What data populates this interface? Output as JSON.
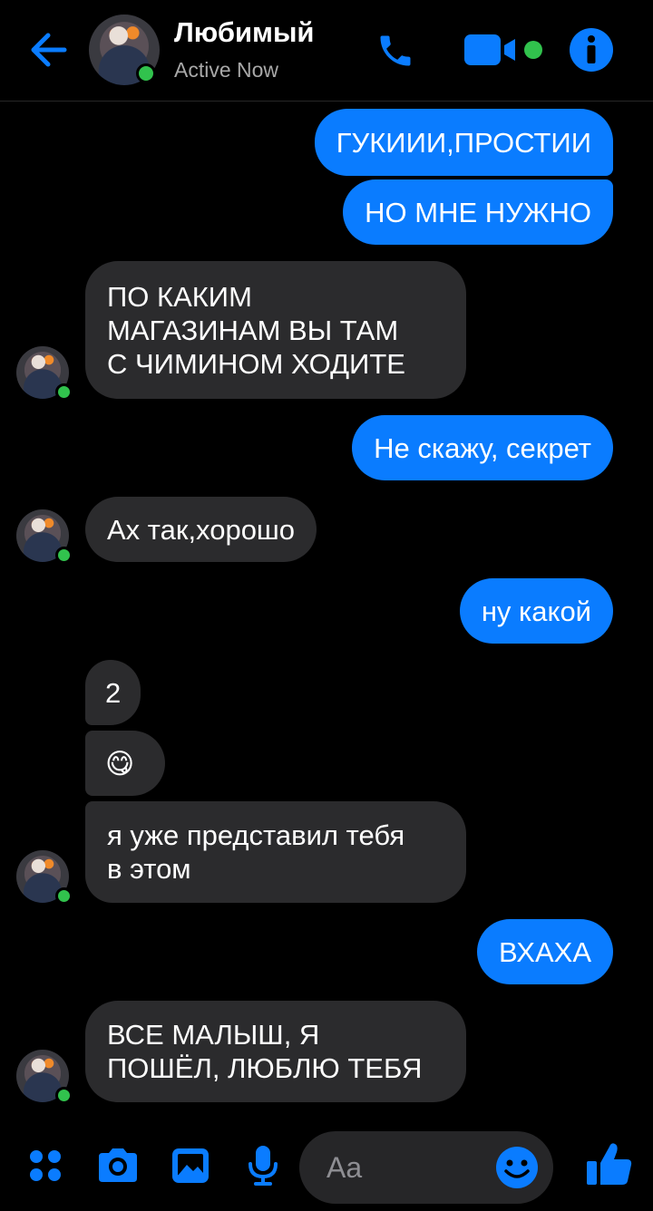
{
  "header": {
    "contact_name": "Любимый",
    "status": "Active Now"
  },
  "colors": {
    "accent": "#0a7cff",
    "incoming_bubble": "#2b2b2d",
    "online": "#31c24d"
  },
  "icons": [
    "back-arrow-icon",
    "phone-icon",
    "video-icon",
    "info-icon",
    "apps-icon",
    "camera-icon",
    "gallery-icon",
    "mic-icon",
    "emoji-icon",
    "like-icon"
  ],
  "messages": [
    {
      "dir": "out",
      "text": "ГУКИИИ,ПРОСТИИ"
    },
    {
      "dir": "out",
      "text": "НО МНЕ НУЖНО"
    },
    {
      "dir": "in",
      "text": "ПО КАКИМ\nМАГАЗИНАМ ВЫ ТАМ\nС ЧИМИНОМ  ХОДИТЕ"
    },
    {
      "dir": "out",
      "text": "Не скажу, секрет"
    },
    {
      "dir": "in",
      "text": "Ах так,хорошо"
    },
    {
      "dir": "out",
      "text": "ну какой"
    },
    {
      "dir": "in",
      "text": "2"
    },
    {
      "dir": "in",
      "text": "😋"
    },
    {
      "dir": "in",
      "text": "я уже представил тебя\nв этом"
    },
    {
      "dir": "out",
      "text": "ВХАХА"
    },
    {
      "dir": "in",
      "text": "ВСЕ МАЛЫШ, Я\nПОШЁЛ, ЛЮБЛЮ ТЕБЯ"
    }
  ],
  "composer": {
    "placeholder": "Aa"
  }
}
